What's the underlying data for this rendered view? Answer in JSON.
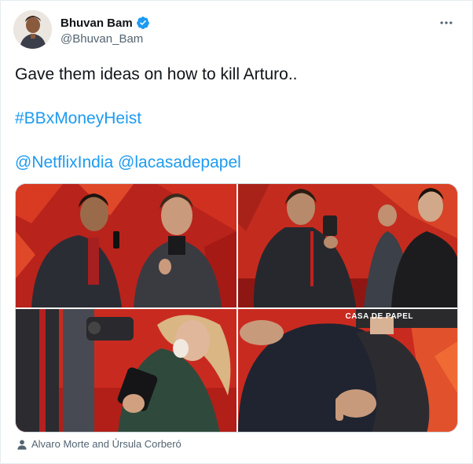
{
  "author": {
    "display_name": "Bhuvan Bam",
    "handle": "@Bhuvan_Bam",
    "verified": true,
    "avatar_icon": "avatar-photo"
  },
  "tweet": {
    "line1": "Gave them ideas on how to kill Arturo..",
    "hashtag": "#BBxMoneyHeist",
    "mention1": "@NetflixIndia",
    "mention2": "@lacasadepapel"
  },
  "media": {
    "photo_count": 4,
    "tagged_people": "Alvaro Morte and Úrsula Corberó",
    "banner_text": "CASA DE PAPEL"
  },
  "icons": {
    "more": "more-horizontal-icon",
    "verified": "verified-badge-icon",
    "person": "person-icon"
  },
  "colors": {
    "link": "#1d9bf0",
    "secondary_text": "#536471",
    "verified": "#1d9bf0",
    "carpet_red": "#c91d1d"
  }
}
